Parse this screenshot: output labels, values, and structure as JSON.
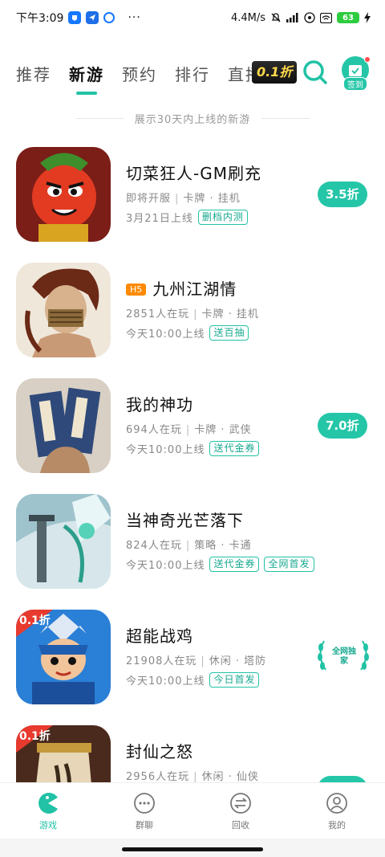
{
  "status_bar": {
    "time": "下午3:09",
    "more": "···",
    "network_speed": "4.4M/s",
    "battery": "63"
  },
  "tabs": [
    {
      "label": "推荐",
      "active": false
    },
    {
      "label": "新游",
      "active": true
    },
    {
      "label": "预约",
      "active": false
    },
    {
      "label": "排行",
      "active": false
    },
    {
      "label": "直播",
      "active": false
    }
  ],
  "promo_badge": "0.1折",
  "signin_label": "签到",
  "notice": "展示30天内上线的新游",
  "games": [
    {
      "title": "切菜狂人-GM刷充",
      "h5": "",
      "meta": [
        "即将开服",
        "卡牌 · 挂机"
      ],
      "release": "3月21日上线",
      "tags": [
        "删档内测"
      ],
      "discount": "3.5折",
      "icon": "hot-pepper-warrior-icon",
      "badge_corner": ""
    },
    {
      "title": "九州江湖情",
      "h5": "H5",
      "meta": [
        "2851人在玩",
        "卡牌 · 挂机"
      ],
      "release": "今天10:00上线",
      "tags": [
        "送百抽"
      ],
      "discount": "",
      "icon": "masked-swordsman-icon",
      "badge_corner": ""
    },
    {
      "title": "我的神功",
      "h5": "",
      "meta": [
        "694人在玩",
        "卡牌 · 武侠"
      ],
      "release": "今天10:00上线",
      "tags": [
        "送代金券"
      ],
      "discount": "7.0折",
      "icon": "martial-arts-books-icon",
      "badge_corner": ""
    },
    {
      "title": "当神奇光芒落下",
      "h5": "",
      "meta": [
        "824人在玩",
        "策略 · 卡通"
      ],
      "release": "今天10:00上线",
      "tags": [
        "送代金券",
        "全网首发"
      ],
      "discount": "",
      "icon": "sword-beam-icon",
      "badge_corner": ""
    },
    {
      "title": "超能战鸡",
      "h5": "",
      "meta": [
        "21908人在玩",
        "休闲 · 塔防"
      ],
      "release": "今天10:00上线",
      "tags": [
        "今日首发"
      ],
      "discount": "",
      "exclusive": "全网独家",
      "icon": "armored-chicken-hero-icon",
      "badge_corner": "0.1折"
    },
    {
      "title": "封仙之怒",
      "h5": "",
      "meta": [
        "2956人在玩",
        "休闲 · 仙侠"
      ],
      "release": "",
      "tags": [],
      "discount": "0.1折",
      "icon": "immortal-tablet-icon",
      "badge_corner": "0.1折"
    }
  ],
  "bottom_nav": [
    {
      "label": "游戏",
      "icon": "pacman-icon",
      "active": true
    },
    {
      "label": "群聊",
      "icon": "chat-bubble-icon",
      "active": false
    },
    {
      "label": "回收",
      "icon": "exchange-icon",
      "active": false
    },
    {
      "label": "我的",
      "icon": "profile-icon",
      "active": false
    }
  ],
  "colors": {
    "accent": "#21c2a5",
    "h5_badge": "#ff8a00"
  }
}
